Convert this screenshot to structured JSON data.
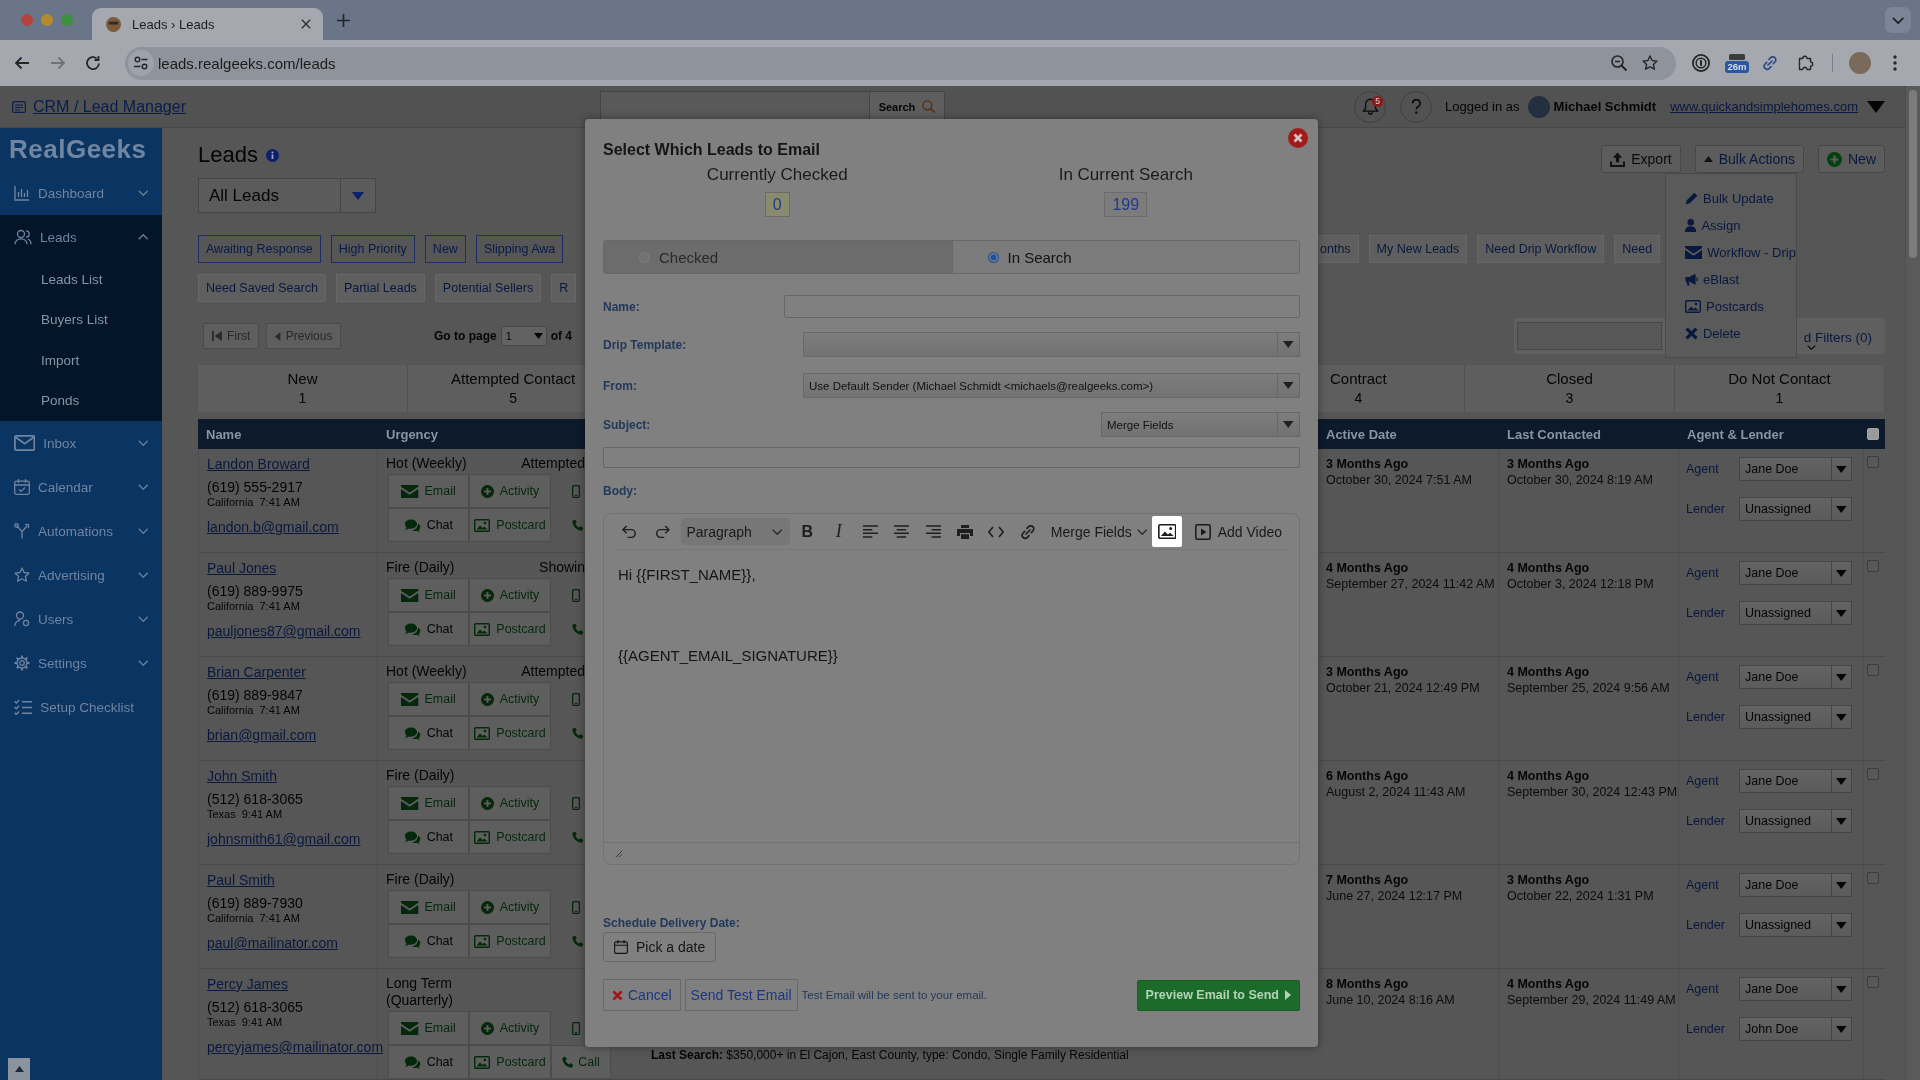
{
  "browser": {
    "tab_title": "Leads › Leads",
    "url": "leads.realgeeks.com/leads",
    "extension_badge": "26m"
  },
  "header": {
    "app_link": "CRM / Lead Manager",
    "search_button": "Search",
    "notification_count": "5",
    "logged_in_label": "Logged in as",
    "user_name": "Michael Schmidt",
    "site_link": "www.quickandsimplehomes.com"
  },
  "sidebar": {
    "logo": "RealGeeks",
    "items": [
      {
        "label": "Dashboard",
        "kind": "group",
        "expanded": false
      },
      {
        "label": "Leads",
        "kind": "group",
        "expanded": true,
        "children": [
          {
            "label": "Leads List"
          },
          {
            "label": "Buyers List"
          },
          {
            "label": "Import"
          },
          {
            "label": "Ponds"
          }
        ]
      },
      {
        "label": "Inbox",
        "kind": "group",
        "expanded": false
      },
      {
        "label": "Calendar",
        "kind": "group",
        "expanded": false
      },
      {
        "label": "Automations",
        "kind": "group",
        "expanded": false
      },
      {
        "label": "Advertising",
        "kind": "group",
        "expanded": false
      },
      {
        "label": "Users",
        "kind": "group",
        "expanded": false
      },
      {
        "label": "Settings",
        "kind": "group",
        "expanded": false
      },
      {
        "label": "Setup Checklist",
        "kind": "link"
      }
    ]
  },
  "page": {
    "title": "Leads",
    "view_select": "All Leads",
    "buttons": [
      "Export",
      "Bulk Actions",
      "New"
    ],
    "bulk_menu": {
      "open": true,
      "items": [
        "Bulk Update",
        "Assign",
        "Workflow - Drip",
        "eBlast",
        "Postcards",
        "Delete"
      ]
    },
    "filters_left": [
      [
        {
          "label": "Awaiting Response",
          "kind": "outlined"
        },
        {
          "label": "High Priority",
          "kind": "outlined"
        },
        {
          "label": "New",
          "kind": "outlined"
        },
        {
          "label": "Slipping Awa",
          "kind": "outlined"
        }
      ],
      [
        {
          "label": "Need Saved Search",
          "kind": "plain"
        },
        {
          "label": "Partial Leads",
          "kind": "plain"
        },
        {
          "label": "Potential Sellers",
          "kind": "plain"
        },
        {
          "label": "R",
          "kind": "plain"
        }
      ]
    ],
    "filters_right": [
      {
        "label": "onths",
        "kind": "plain"
      },
      {
        "label": "My New Leads",
        "kind": "plain"
      },
      {
        "label": "Need Drip Workflow",
        "kind": "plain"
      },
      {
        "label": "Need",
        "kind": "plain"
      }
    ],
    "pagination": {
      "first": "First",
      "previous": "Previous",
      "nav_disabled": true,
      "goto_label": "Go to page",
      "page": "1",
      "total": "of 4"
    },
    "advanced_filters": "d Filters (0)",
    "status_counts_left": [
      {
        "label": "New",
        "count": "1"
      },
      {
        "label": "Attempted Contact",
        "count": "5"
      }
    ],
    "status_counts_right": [
      {
        "label": "Contract",
        "count": "4"
      },
      {
        "label": "Closed",
        "count": "3"
      },
      {
        "label": "Do Not Contact",
        "count": "1"
      }
    ],
    "table": {
      "columns_left": [
        "Name",
        "Urgency"
      ],
      "columns_right": [
        "Active Date",
        "Last Contacted",
        "Agent & Lender"
      ],
      "select_all_checked": false,
      "rows": [
        {
          "name": "Landon Broward",
          "phone": "(619) 555-2917",
          "region": "California",
          "local_time": "7:41 AM",
          "email": "landon.b@gmail.com",
          "urgency": "Hot (Weekly)",
          "status": "Attempted",
          "actions": [
            "Email",
            "Activity",
            "Chat",
            "Postcard"
          ],
          "active_ago": "3 Months Ago",
          "active_date": "October 30, 2024 7:51 AM",
          "contacted_ago": "3 Months Ago",
          "contacted_date": "October 30, 2024 8:19 AM",
          "agent_label": "Agent",
          "agent": "Jane Doe",
          "lender_label": "Lender",
          "lender": "Unassigned",
          "checked": false
        },
        {
          "name": "Paul Jones",
          "phone": "(619) 889-9975",
          "region": "California",
          "local_time": "7:41 AM",
          "email": "pauljones87@gmail.com",
          "urgency": "Fire (Daily)",
          "status": "Showin",
          "actions": [
            "Email",
            "Activity",
            "Chat",
            "Postcard"
          ],
          "active_ago": "4 Months Ago",
          "active_date": "September 27, 2024 11:42 AM",
          "contacted_ago": "4 Months Ago",
          "contacted_date": "October 3, 2024 12:18 PM",
          "agent_label": "Agent",
          "agent": "Jane Doe",
          "lender_label": "Lender",
          "lender": "Unassigned",
          "checked": false
        },
        {
          "name": "Brian Carpenter",
          "phone": "(619) 889-9847",
          "region": "California",
          "local_time": "7:41 AM",
          "email": "brian@gmail.com",
          "urgency": "Hot (Weekly)",
          "status": "Attempted",
          "actions": [
            "Email",
            "Activity",
            "Chat",
            "Postcard"
          ],
          "active_ago": "3 Months Ago",
          "active_date": "October 21, 2024 12:49 PM",
          "contacted_ago": "4 Months Ago",
          "contacted_date": "September 25, 2024 9:56 AM",
          "agent_label": "Agent",
          "agent": "Jane Doe",
          "lender_label": "Lender",
          "lender": "Unassigned",
          "checked": false
        },
        {
          "name": "John Smith",
          "phone": "(512) 618-3065",
          "region": "Texas",
          "local_time": "9:41 AM",
          "email": "johnsmith61@gmail.com",
          "urgency": "Fire (Daily)",
          "actions": [
            "Email",
            "Activity",
            "Chat",
            "Postcard"
          ],
          "active_ago": "6 Months Ago",
          "active_date": "August 2, 2024 11:43 AM",
          "contacted_ago": "4 Months Ago",
          "contacted_date": "September 30, 2024 12:43 PM",
          "agent_label": "Agent",
          "agent": "Jane Doe",
          "lender_label": "Lender",
          "lender": "Unassigned",
          "checked": false
        },
        {
          "name": "Paul Smith",
          "phone": "(619) 889-7930",
          "region": "California",
          "local_time": "7:41 AM",
          "email": "paul@mailinator.com",
          "urgency": "Fire (Daily)",
          "actions": [
            "Email",
            "Activity",
            "Chat",
            "Postcard"
          ],
          "active_ago": "7 Months Ago",
          "active_date": "June 27, 2024 12:17 PM",
          "contacted_ago": "3 Months Ago",
          "contacted_date": "October 22, 2024 1:31 PM",
          "agent_label": "Agent",
          "agent": "Jane Doe",
          "lender_label": "Lender",
          "lender": "Unassigned",
          "checked": false
        },
        {
          "name": "Percy James",
          "phone": "(512) 618-3065",
          "region": "Texas",
          "local_time": "9:41 AM",
          "email": "percyjames@mailinator.com",
          "urgency": "Long Term (Quarterly)",
          "actions": [
            "Email",
            "Activity",
            "Chat",
            "Postcard"
          ],
          "call_label": "Call",
          "last_search": "**Last Search:** $350,000+ in El Cajon, East County, type: Condo, Single Family Residential",
          "active_ago": "8 Months Ago",
          "active_date": "June 10, 2024 8:16 AM",
          "contacted_ago": "4 Months Ago",
          "contacted_date": "September 29, 2024 11:49 AM",
          "agent_label": "Agent",
          "agent": "Jane Doe",
          "lender_label": "Lender",
          "lender": "John Doe",
          "checked": false
        }
      ]
    }
  },
  "dialog": {
    "title": "Select Which Leads to Email",
    "counts": [
      {
        "label": "Currently Checked",
        "value": "0",
        "color": "#8a8a6c"
      },
      {
        "label": "In Current Search",
        "value": "199",
        "color": "#7c7c7c"
      }
    ],
    "recipients": [
      {
        "label": "Checked",
        "selected": false
      },
      {
        "label": "In Search",
        "selected": true
      }
    ],
    "name": {
      "label": "Name:"
    },
    "drip_template": {
      "label": "Drip Template:"
    },
    "from": {
      "label": "From:",
      "value": "Use Default Sender (Michael Schmidt <michaels@realgeeks.com>)"
    },
    "subject": {
      "label": "Subject:",
      "merge_fields": "Merge Fields"
    },
    "body": {
      "label": "Body:",
      "style_select": "Paragraph",
      "bold_key": "B",
      "italic_key": "I",
      "merge_fields": "Merge Fields",
      "add_video": "Add Video",
      "image_highlighted": true,
      "content": [
        "Hi {{FIRST_NAME}},",
        "{{AGENT_EMAIL_SIGNATURE}}"
      ]
    },
    "schedule": {
      "label": "Schedule Delivery Date:",
      "button": "Pick a date"
    },
    "footer": {
      "cancel": "Cancel",
      "send_test": "Send Test Email",
      "note": "Test Email will be sent to your email.",
      "preview": "Preview Email to Send"
    }
  }
}
